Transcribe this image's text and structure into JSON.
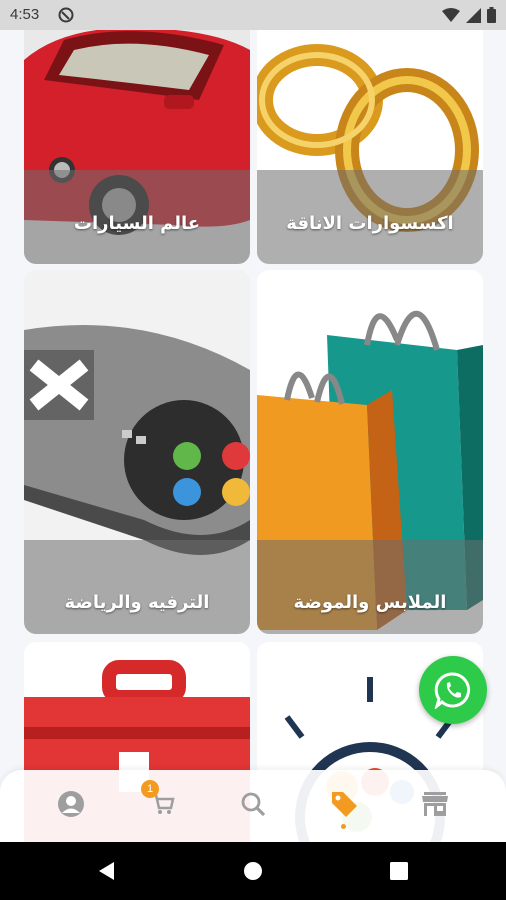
{
  "status_bar": {
    "time": "4:53",
    "icons": [
      "dnd-icon",
      "wifi-icon",
      "signal-icon",
      "battery-icon"
    ]
  },
  "categories": [
    {
      "label": "عالم السيارات",
      "icon": "car-image"
    },
    {
      "label": "اكسسوارات الاناقة",
      "icon": "rings-image"
    },
    {
      "label": "الترفيه والرياضة",
      "icon": "gamepad-image"
    },
    {
      "label": "الملابس والموضة",
      "icon": "shopping-bags-image"
    },
    {
      "label": "",
      "icon": "toolbox-image"
    },
    {
      "label": "",
      "icon": "gears-bulb-image"
    }
  ],
  "fab": {
    "icon": "whatsapp-icon"
  },
  "bottom_nav": {
    "items": [
      {
        "icon": "account-icon"
      },
      {
        "icon": "cart-icon",
        "badge": "1"
      },
      {
        "icon": "search-icon"
      },
      {
        "icon": "tag-icon",
        "active": true
      },
      {
        "icon": "store-icon"
      }
    ],
    "active_color": "#f29b20",
    "inactive_color": "#9e9e9e"
  },
  "system_nav": {
    "buttons": [
      "back-icon",
      "home-icon",
      "recents-icon"
    ]
  }
}
